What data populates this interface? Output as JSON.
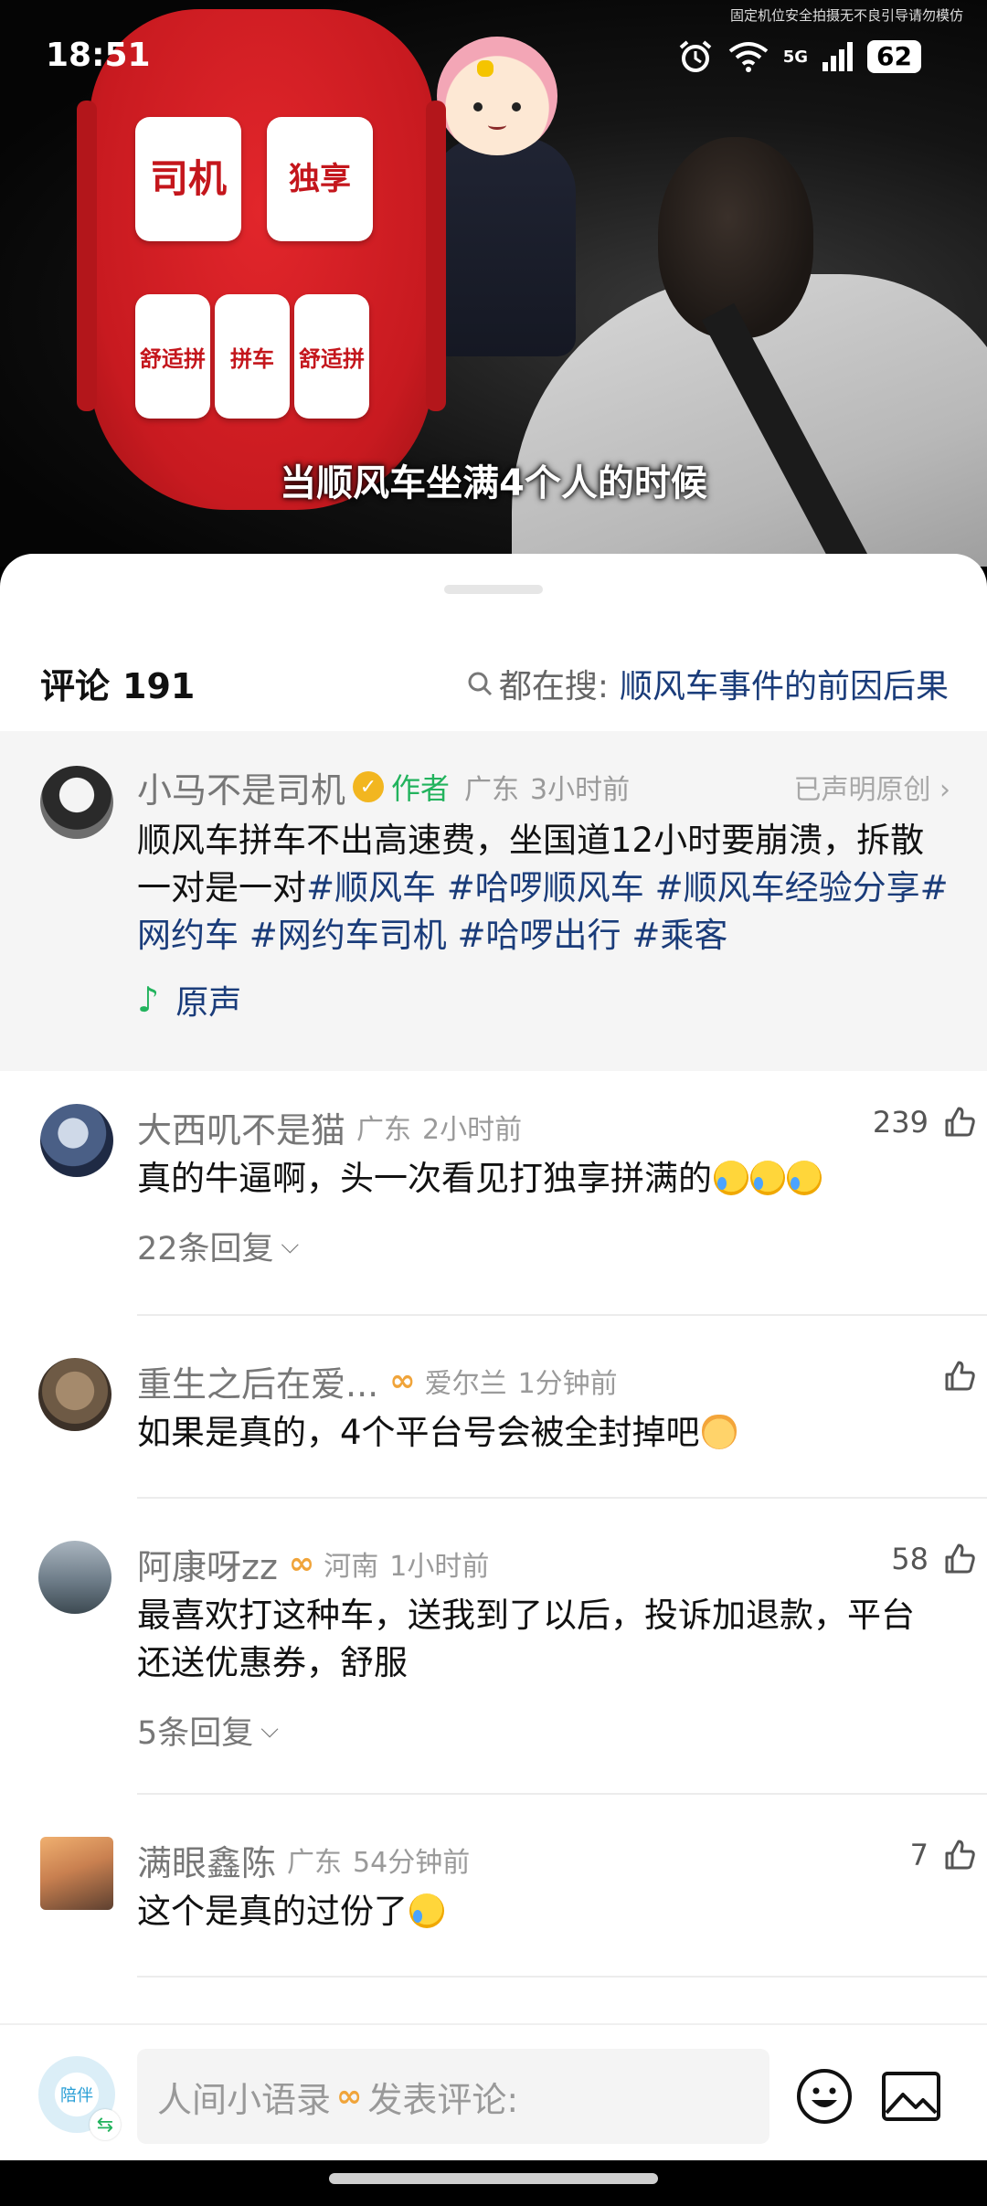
{
  "status_bar": {
    "time": "18:51",
    "network": "5G",
    "battery": "62"
  },
  "video": {
    "watermark": "固定机位安全拍摄无不良引导请勿模仿",
    "subtitle": "当顺风车坐满4个人的时候",
    "seats": {
      "driver": "司机",
      "exclusive": "独享",
      "seat1": "舒适拼",
      "seat2": "拼车",
      "seat3": "舒适拼"
    }
  },
  "comments_header": {
    "label": "评论",
    "count": "191",
    "search_prefix": "都在搜:",
    "search_keyword": "顺风车事件的前因后果"
  },
  "author_post": {
    "name": "小马不是司机",
    "author_tag": "作者",
    "location": "广东",
    "time": "3小时前",
    "original": "已声明原创",
    "text": "顺风车拼车不出高速费，坐国道12小时要崩溃，拆散一对是一对",
    "tags": [
      "#顺风车",
      "#哈啰顺风车",
      "#顺风车经验分享",
      "#网约车",
      "#网约车司机",
      "#哈啰出行",
      "#乘客"
    ],
    "music": "原声"
  },
  "comments": [
    {
      "name": "大西叽不是猫",
      "location": "广东",
      "time": "2小时前",
      "likes": "239",
      "text": "真的牛逼啊，头一次看见打独享拼满的",
      "replies": "22条回复"
    },
    {
      "name": "重生之后在爱...",
      "location": "爱尔兰",
      "time": "1分钟前",
      "likes": "",
      "text": "如果是真的，4个平台号会被全封掉吧"
    },
    {
      "name": "阿康呀zz",
      "location": "河南",
      "time": "1小时前",
      "likes": "58",
      "text": "最喜欢打这种车，送我到了以后，投诉加退款，平台还送优惠券，舒服",
      "replies": "5条回复"
    },
    {
      "name": "满眼鑫陈",
      "location": "广东",
      "time": "54分钟前",
      "likes": "7",
      "text": "这个是真的过份了"
    }
  ],
  "bottom_bar": {
    "avatar_text": "陪伴",
    "user": "人间小语录",
    "placeholder": "发表评论:"
  },
  "colors": {
    "accent_link": "#1a3c7a",
    "author_green": "#22b35d",
    "vip_orange": "#f0a43a",
    "seat_red": "#c81a20"
  }
}
